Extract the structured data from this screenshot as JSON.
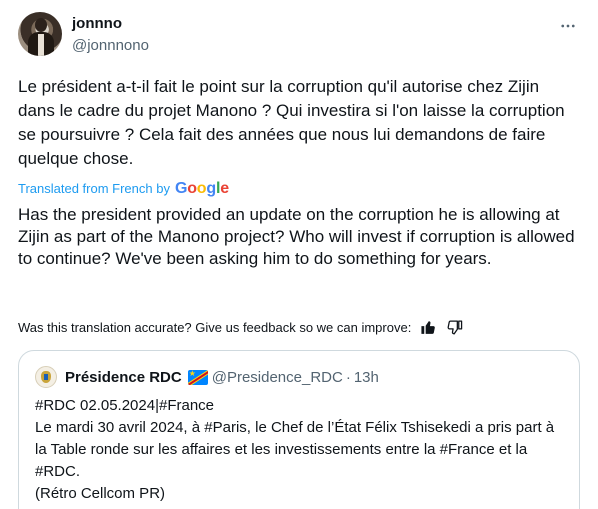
{
  "author": {
    "display_name": "jonnno",
    "handle": "@jonnnono"
  },
  "tweet": {
    "original_text": "Le président a-t-il fait le point sur la corruption qu'il autorise chez Zijin dans le cadre du projet Manono ? Qui investira si l'on laisse la corruption se poursuivre ? Cela fait des années que nous lui demandons de faire quelque chose.",
    "translated_from": "Translated from French by",
    "google_letters": [
      "G",
      "o",
      "o",
      "g",
      "l",
      "e"
    ],
    "translated_text": "Has the president provided an update on the corruption he is allowing at Zijin as part of the Manono project? Who will invest if corruption is allowed to continue? We've been asking him to do something for years.",
    "feedback_prompt": "Was this translation accurate? Give us feedback so we can improve:"
  },
  "icons": {
    "more": "more-horizontal-icon",
    "thumbs_up": "thumbs-up-icon",
    "thumbs_down": "thumbs-down-icon",
    "flag": "drc-flag-icon"
  },
  "quoted": {
    "display_name": "Présidence RDC",
    "handle": "@Presidence_RDC",
    "separator": "·",
    "time": "13h",
    "lines": [
      "#RDC 02.05.2024|#France",
      "Le mardi 30 avril 2024, à #Paris, le Chef de l’État Félix Tshisekedi a pris part à la Table ronde sur les affaires et les investissements entre la #France et la #RDC.",
      "(Rétro Cellcom PR)"
    ]
  },
  "colors": {
    "link_blue": "#1d9bf0",
    "text_primary": "#0f1419",
    "text_secondary": "#536471",
    "border": "#cfd9de"
  }
}
